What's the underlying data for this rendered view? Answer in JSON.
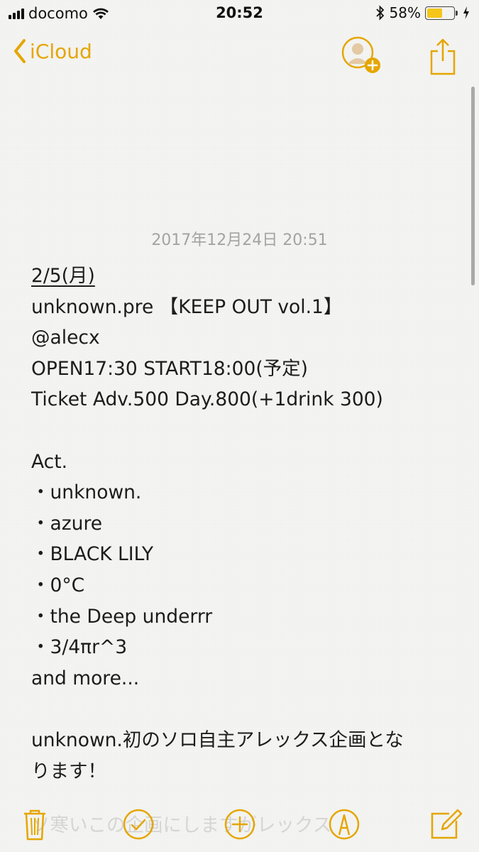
{
  "status_bar": {
    "carrier": "docomo",
    "time": "20:52",
    "battery_percent": "58%",
    "battery_level": 0.58,
    "icons": [
      "signal-icon",
      "wifi-icon",
      "bluetooth-icon",
      "battery-icon",
      "charging-icon"
    ]
  },
  "nav": {
    "back_label": "iCloud",
    "accent_color": "#e5a600"
  },
  "note": {
    "date": "2017年12月24日 20:51",
    "lines": [
      "2/5(月)",
      "unknown.pre 【KEEP OUT vol.1】",
      "@alecx",
      "OPEN17:30 START18:00(予定)",
      "Ticket Adv.500 Day.800(+1drink 300)",
      "",
      "Act.",
      "・unknown.",
      "・azure",
      "・BLACK LILY",
      "・0°C",
      "・the Deep underrr",
      "・3/4πr^3",
      "and more...",
      "",
      "unknown.初のソロ自主アレックス企画とな",
      "ります！"
    ],
    "ghost_text": "ソ寒いこの企画にしますがレックス"
  },
  "toolbar": {
    "icons": [
      "trash-icon",
      "checklist-icon",
      "add-icon",
      "markup-icon",
      "compose-icon"
    ]
  }
}
